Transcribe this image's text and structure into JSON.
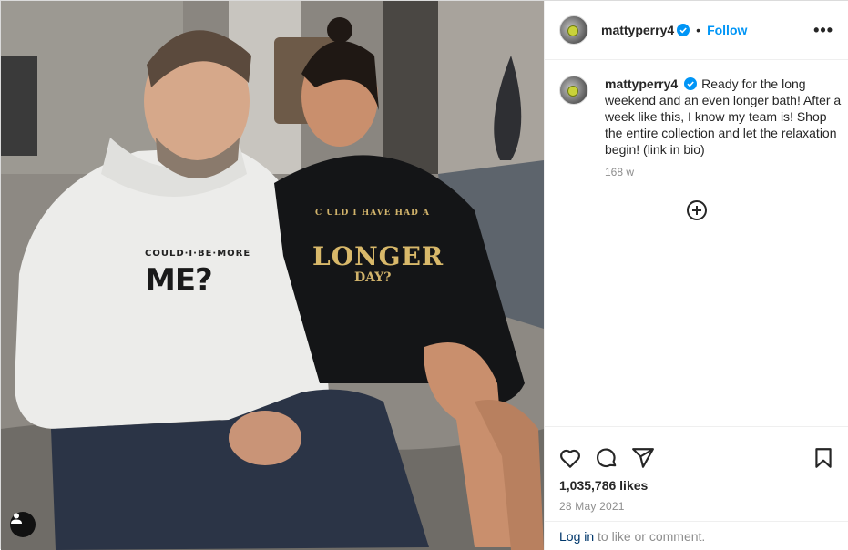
{
  "post": {
    "username": "mattyperry4",
    "follow_label": "Follow",
    "separator": "•",
    "more_options": "•••",
    "caption": "Ready for the long weekend and an even longer bath! After a week like this, I know my team is! Shop the entire collection and let the relaxation begin! (link in bio)",
    "time_ago": "168 w",
    "likes": "1,035,786 likes",
    "date": "28 May 2021",
    "login_link": "Log in",
    "login_rest": " to like or comment."
  },
  "photo": {
    "hoodie_small_print": "COULD·I·BE·MORE",
    "hoodie_big_print": "ME?",
    "sweater_print_line1": "C ULD I HAVE HAD A",
    "sweater_print_line2": "LONGER",
    "sweater_print_line3": "DAY?"
  },
  "icons": {
    "verified": "verified-badge-icon",
    "add_comment": "plus-circle-icon",
    "like": "heart-icon",
    "comment": "comment-bubble-icon",
    "share": "paper-plane-icon",
    "save": "bookmark-icon",
    "tags": "user-tag-icon"
  },
  "colors": {
    "accent": "#0095f6",
    "verified": "#0095f6",
    "secondary_text": "#8e8e8e",
    "link": "#00376b"
  }
}
